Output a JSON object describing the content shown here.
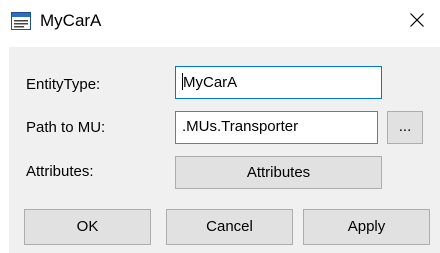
{
  "window": {
    "title": "MyCarA",
    "icon": "window-app-icon",
    "close_glyph": "✕"
  },
  "form": {
    "entity_type": {
      "label": "EntityType:",
      "value": "MyCarA"
    },
    "path_to_mu": {
      "label": "Path to MU:",
      "value": ".MUs.Transporter",
      "browse_label": "..."
    },
    "attributes": {
      "label": "Attributes:",
      "button_label": "Attributes"
    }
  },
  "buttons": {
    "ok": "OK",
    "cancel": "Cancel",
    "apply": "Apply"
  },
  "colors": {
    "focus_border": "#0078d7",
    "dialog_bg": "#f0f0f0",
    "button_bg": "#e1e1e1"
  }
}
